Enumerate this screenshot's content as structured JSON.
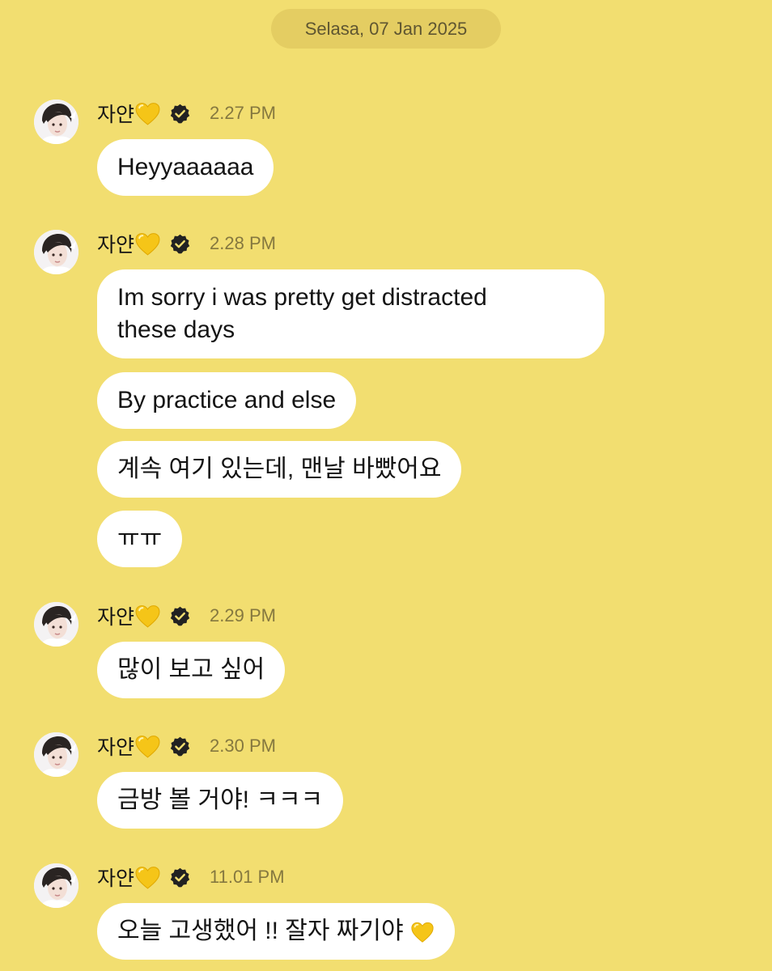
{
  "date_label": "Selasa, 07 Jan 2025",
  "sender": {
    "name": "자얀",
    "name_emoji": "yellow-heart-icon",
    "verified_icon": "verified-badge-icon"
  },
  "colors": {
    "background": "#f2de70",
    "date_pill": "#e4cd62",
    "bubble": "#ffffff",
    "time_text": "#85783f",
    "heart": "#f5c518"
  },
  "groups": [
    {
      "time": "2.27 PM",
      "messages": [
        "Heyyaaaaaa"
      ]
    },
    {
      "time": "2.28 PM",
      "messages": [
        "Im sorry i was pretty get distracted\nthese days",
        "By practice and else",
        "계속 여기 있는데, 맨날 바빴어요",
        "ㅠㅠ"
      ]
    },
    {
      "time": "2.29 PM",
      "messages": [
        "많이 보고 싶어"
      ]
    },
    {
      "time": "2.30 PM",
      "messages": [
        "금방 볼 거야! ㅋㅋㅋ"
      ]
    },
    {
      "time": "11.01 PM",
      "messages": [
        "오늘 고생했어 !! 잘자 짜기야"
      ]
    }
  ],
  "last_message_emoji": "yellow-heart-icon"
}
